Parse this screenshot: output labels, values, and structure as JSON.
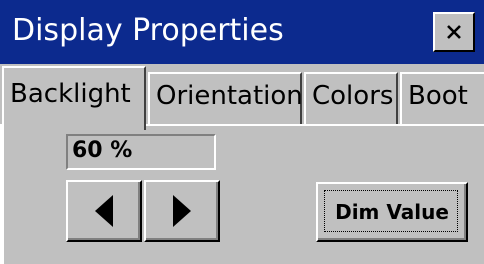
{
  "window": {
    "title": "Display Properties"
  },
  "tabs": [
    {
      "label": "Backlight",
      "selected": true
    },
    {
      "label": "Orientation",
      "selected": false
    },
    {
      "label": "Colors",
      "selected": false
    },
    {
      "label": "Boot",
      "selected": false
    }
  ],
  "backlight": {
    "value_text": "60 %",
    "dim_button_label": "Dim Value"
  },
  "icons": {
    "close": "close-icon",
    "decrease": "left-arrow-icon",
    "increase": "right-arrow-icon"
  },
  "colors": {
    "titlebar": "#0c2a8e",
    "face": "#c0c0c0"
  }
}
